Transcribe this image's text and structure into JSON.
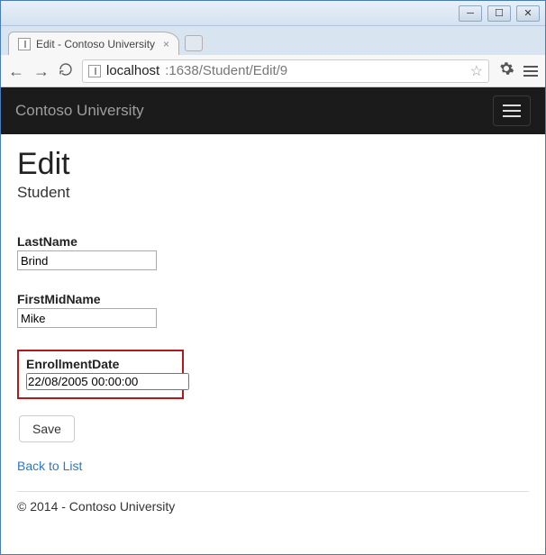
{
  "window": {
    "tab_title": "Edit - Contoso University"
  },
  "addressbar": {
    "host": "localhost",
    "port_path": ":1638/Student/Edit/9"
  },
  "navbar": {
    "brand": "Contoso University"
  },
  "page": {
    "title": "Edit",
    "subtitle": "Student"
  },
  "fields": {
    "lastname": {
      "label": "LastName",
      "value": "Brind"
    },
    "firstmidname": {
      "label": "FirstMidName",
      "value": "Mike"
    },
    "enrollmentdate": {
      "label": "EnrollmentDate",
      "value": "22/08/2005 00:00:00"
    }
  },
  "buttons": {
    "save": "Save",
    "back": "Back to List"
  },
  "footer": {
    "text": "© 2014 - Contoso University"
  }
}
